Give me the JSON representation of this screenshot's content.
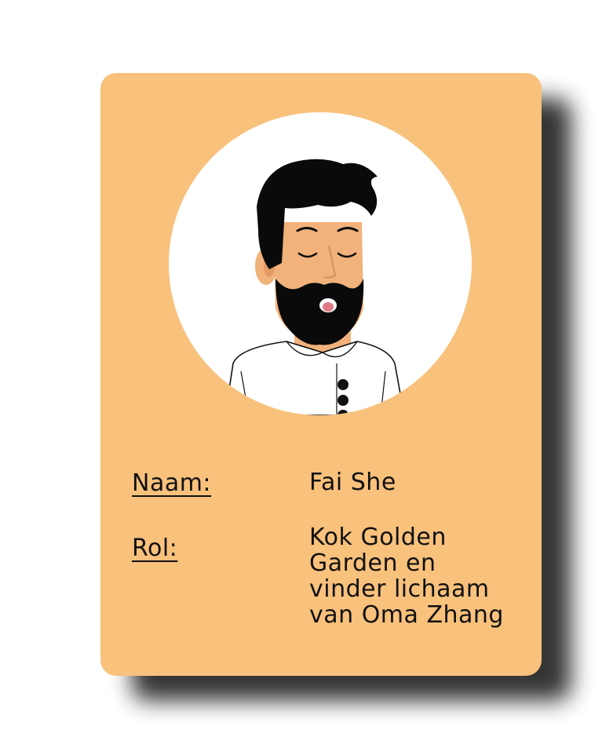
{
  "card": {
    "background_color": "#f8c17c",
    "avatar": {
      "icon": "bearded-chef-avatar-icon",
      "description_colors": {
        "skin": "#f2b27c",
        "hair": "#0a0a0a",
        "jacket": "#ffffff"
      }
    },
    "fields": [
      {
        "label": "Naam:",
        "value": "Fai She"
      },
      {
        "label": "Rol:",
        "value": "Kok Golden\nGarden en\nvinder lichaam\nvan Oma Zhang"
      }
    ]
  }
}
